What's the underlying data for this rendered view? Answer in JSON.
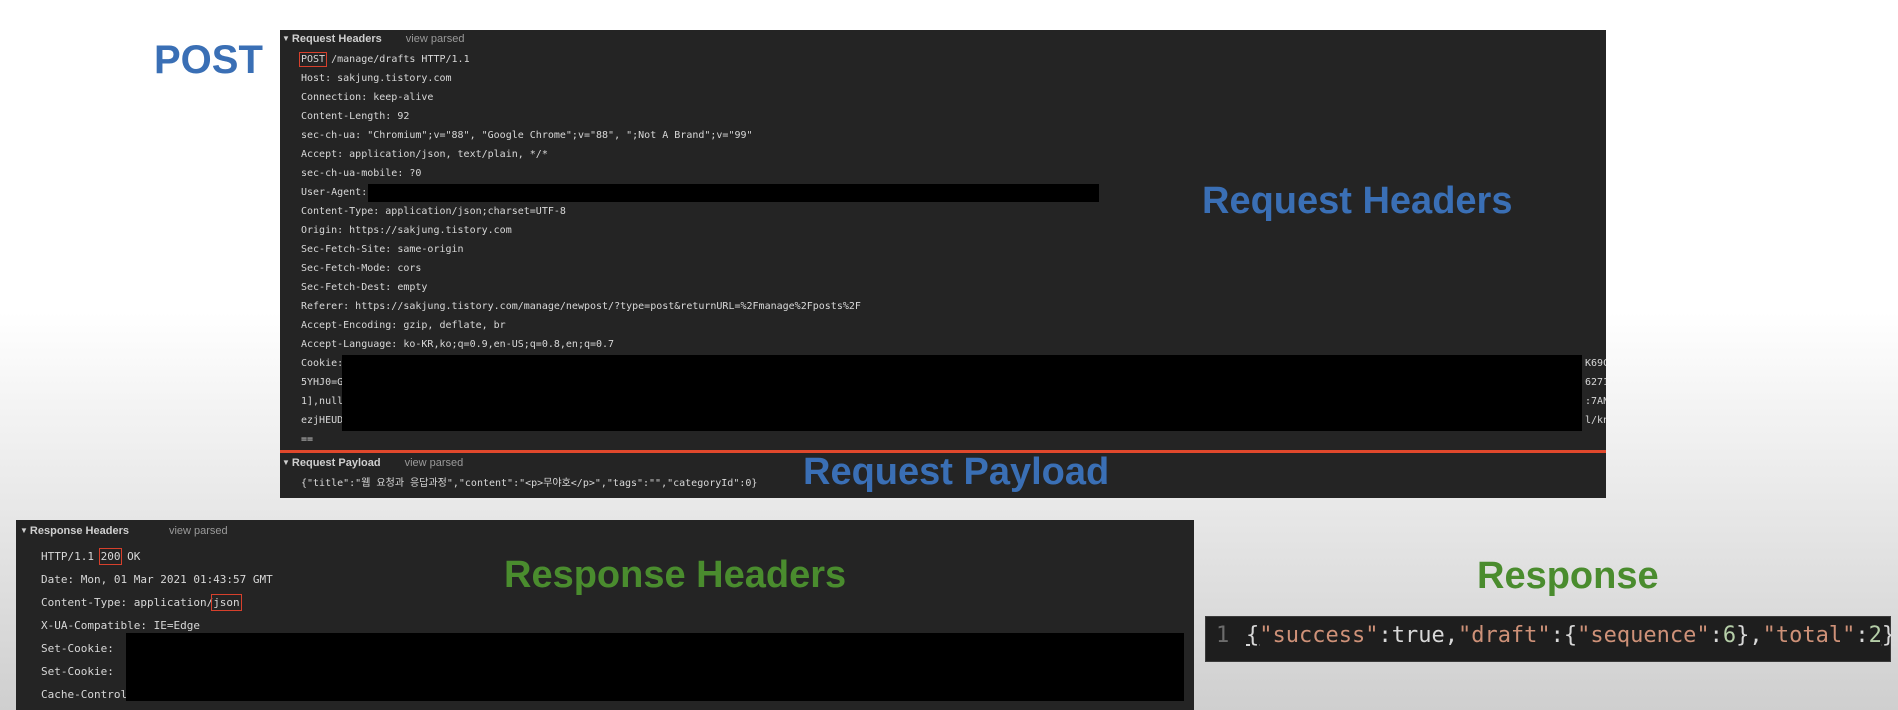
{
  "labels": {
    "post": "POST",
    "request_headers": "Request Headers",
    "request_payload": "Request Payload",
    "response_headers": "Response Headers",
    "response": "Response"
  },
  "request_panel": {
    "headers_section": {
      "title": "Request Headers",
      "view_parsed": "view parsed"
    },
    "request_line": {
      "method": "POST",
      "rest": " /manage/drafts HTTP/1.1"
    },
    "headers": [
      "Host: sakjung.tistory.com",
      "Connection: keep-alive",
      "Content-Length: 92",
      "sec-ch-ua: \"Chromium\";v=\"88\", \"Google Chrome\";v=\"88\", \";Not A Brand\";v=\"99\"",
      "Accept: application/json, text/plain, */*",
      "sec-ch-ua-mobile: ?0",
      "User-Agent:",
      "Content-Type: application/json;charset=UTF-8",
      "Origin: https://sakjung.tistory.com",
      "Sec-Fetch-Site: same-origin",
      "Sec-Fetch-Mode: cors",
      "Sec-Fetch-Dest: empty",
      "Referer: https://sakjung.tistory.com/manage/newpost/?type=post&returnURL=%2Fmanage%2Fposts%2F",
      "Accept-Encoding: gzip, deflate, br",
      "Accept-Language: ko-KR,ko;q=0.9,en-US;q=0.8,en;q=0.7"
    ],
    "cookie_lines": {
      "line1": "Cookie:",
      "line2": "5YHJ0=G",
      "line3": "1],null",
      "line4": "ezjHEUD",
      "line5": "==",
      "right1": "K69C",
      "right2": "6271",
      "right3": ":7AN",
      "right4": "l/kn"
    },
    "payload_section": {
      "title": "Request Payload",
      "view_parsed": "view parsed"
    },
    "payload": "{\"title\":\"웹 요청과 응답과정\",\"content\":\"<p>무야호</p>\",\"tags\":\"\",\"categoryId\":0}"
  },
  "response_panel": {
    "headers_section": {
      "title": "Response Headers",
      "view_parsed": "view parsed"
    },
    "status_line": {
      "proto": "HTTP/1.1 ",
      "code": "200",
      "rest": " OK"
    },
    "date": "Date: Mon, 01 Mar 2021 01:43:57 GMT",
    "content_type": {
      "prefix": "Content-Type: application/",
      "value": "json"
    },
    "x_ua": "X-UA-Compatible: IE=Edge",
    "set_cookie_1": "Set-Cookie:",
    "set_cookie_2": "Set-Cookie:",
    "cache_control": "Cache-Control: no-cache, private"
  },
  "response_body": {
    "line_number": "1",
    "tokens": {
      "t1": "{",
      "t2": "\"success\"",
      "t3": ":",
      "t4": "true",
      "t5": ",",
      "t6": "\"draft\"",
      "t7": ":{",
      "t8": "\"sequence\"",
      "t9": ":",
      "t10": "6",
      "t11": "},",
      "t12": "\"total\"",
      "t13": ":",
      "t14": "2",
      "t15": "}"
    }
  },
  "colors": {
    "label_blue": "#3a6fb5",
    "label_green": "#4a8c2e",
    "highlight_red": "#d6402c",
    "panel_bg": "#242424"
  }
}
